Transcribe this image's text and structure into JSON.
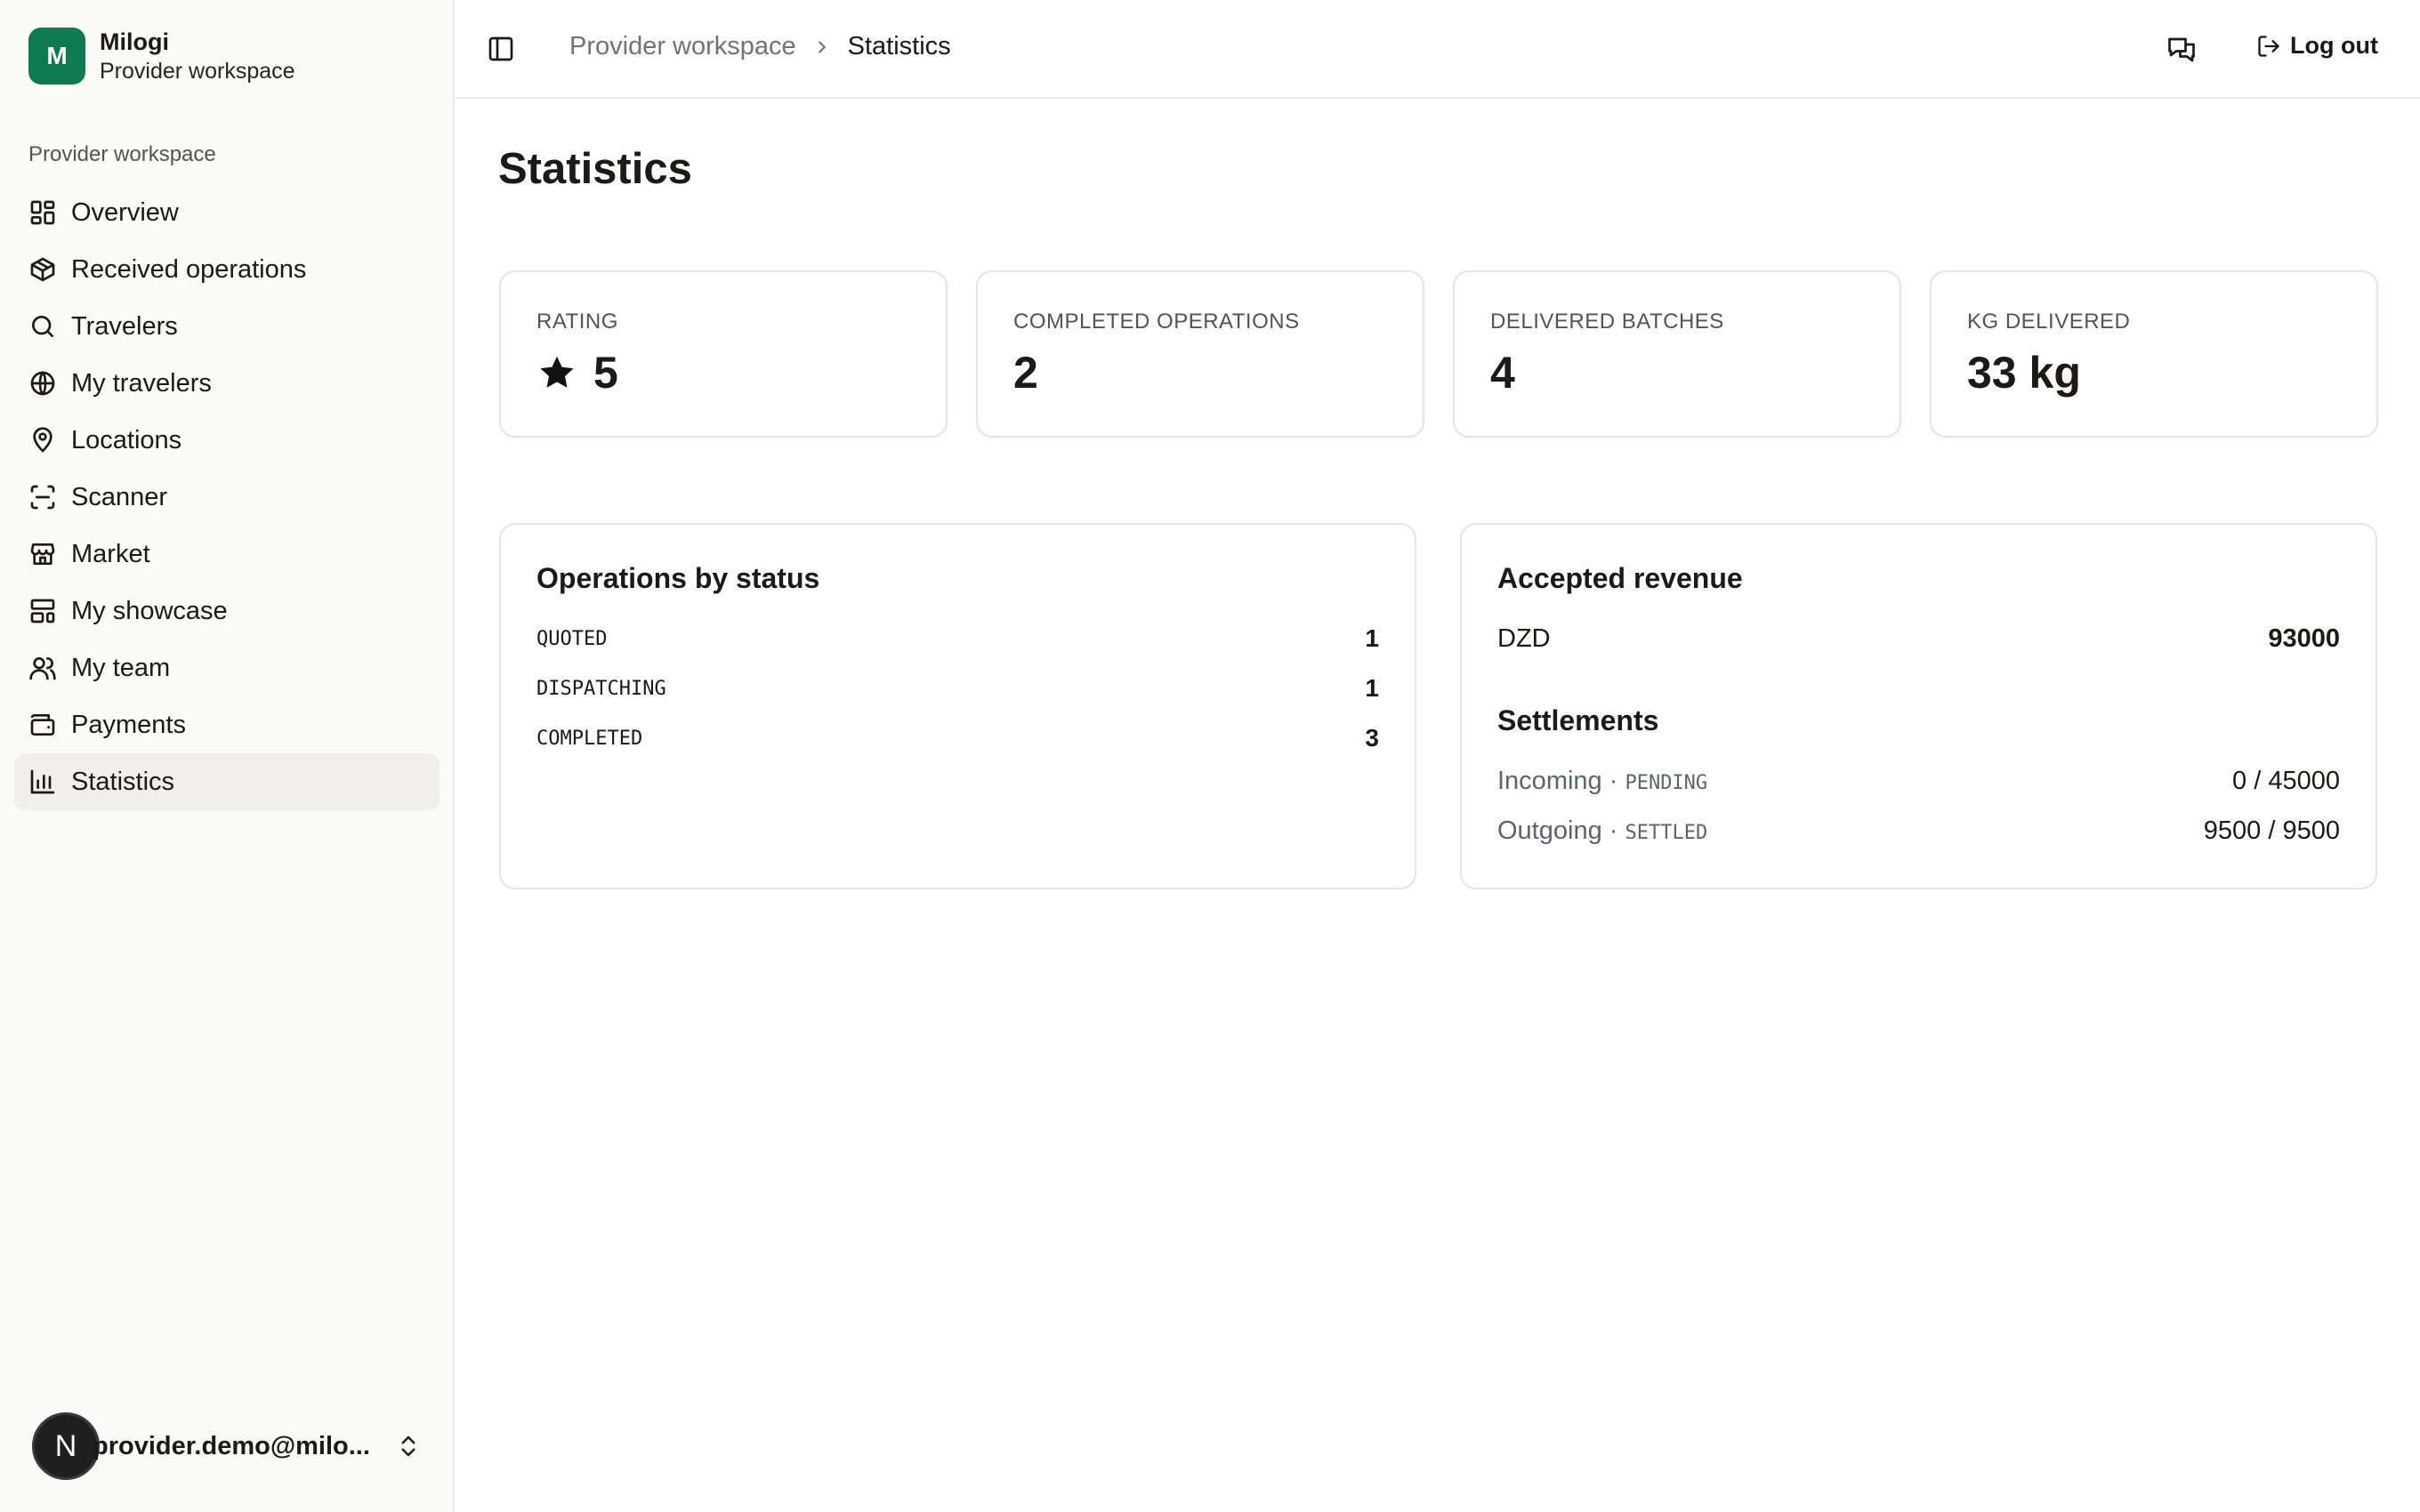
{
  "app": {
    "name": "Milogi",
    "workspace": "Provider workspace",
    "logo_letter": "M"
  },
  "sidebar": {
    "group_label": "Provider workspace",
    "items": [
      {
        "label": "Overview",
        "icon": "layout-grid-icon"
      },
      {
        "label": "Received operations",
        "icon": "package-icon"
      },
      {
        "label": "Travelers",
        "icon": "search-icon"
      },
      {
        "label": "My travelers",
        "icon": "globe-icon"
      },
      {
        "label": "Locations",
        "icon": "map-pin-icon"
      },
      {
        "label": "Scanner",
        "icon": "scan-icon"
      },
      {
        "label": "Market",
        "icon": "store-icon"
      },
      {
        "label": "My showcase",
        "icon": "layout-panel-icon"
      },
      {
        "label": "My team",
        "icon": "users-icon"
      },
      {
        "label": "Payments",
        "icon": "wallet-icon"
      },
      {
        "label": "Statistics",
        "icon": "bar-chart-icon",
        "active": true
      }
    ],
    "user": {
      "avatar_letter": "N",
      "email": "provider.demo@milo..."
    }
  },
  "topbar": {
    "breadcrumb": [
      "Provider workspace",
      "Statistics"
    ],
    "logout_label": "Log out"
  },
  "page": {
    "title": "Statistics"
  },
  "stats": [
    {
      "label": "RATING",
      "value": "5",
      "icon": "star-icon"
    },
    {
      "label": "COMPLETED OPERATIONS",
      "value": "2"
    },
    {
      "label": "DELIVERED BATCHES",
      "value": "4"
    },
    {
      "label": "KG DELIVERED",
      "value": "33 kg"
    }
  ],
  "operations_by_status": {
    "title": "Operations by status",
    "rows": [
      {
        "status": "QUOTED",
        "count": "1"
      },
      {
        "status": "DISPATCHING",
        "count": "1"
      },
      {
        "status": "COMPLETED",
        "count": "3"
      }
    ]
  },
  "revenue": {
    "title": "Accepted revenue",
    "currency": "DZD",
    "amount": "93000",
    "settlements_title": "Settlements",
    "settlements": [
      {
        "direction": "Incoming",
        "state": "PENDING",
        "value": "0 / 45000"
      },
      {
        "direction": "Outgoing",
        "state": "SETTLED",
        "value": "9500 / 9500"
      }
    ]
  },
  "colors": {
    "brand": "#0f7a4f",
    "active_nav_bg": "#f0efec",
    "muted_text": "#57534e"
  }
}
